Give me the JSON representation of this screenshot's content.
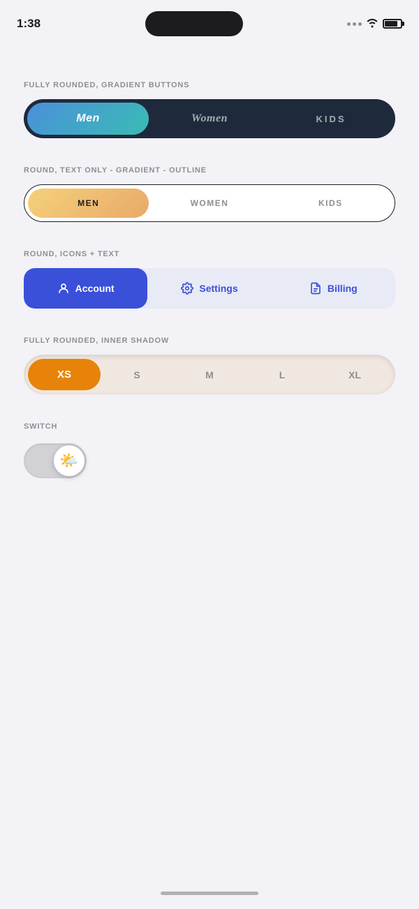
{
  "statusBar": {
    "time": "1:38"
  },
  "sections": {
    "gradientPill": {
      "label": "FULLY ROUNDED, GRADIENT BUTTONS",
      "buttons": [
        {
          "id": "men",
          "label": "Men",
          "active": true
        },
        {
          "id": "women",
          "label": "Women",
          "active": false
        },
        {
          "id": "kids",
          "label": "KIDS",
          "active": false
        }
      ]
    },
    "outlinePill": {
      "label": "ROUND, TEXT ONLY - GRADIENT - OUTLINE",
      "buttons": [
        {
          "id": "men",
          "label": "MEN",
          "active": true
        },
        {
          "id": "women",
          "label": "WOMEN",
          "active": false
        },
        {
          "id": "kids",
          "label": "KIDS",
          "active": false
        }
      ]
    },
    "iconText": {
      "label": "ROUND, ICONS + TEXT",
      "buttons": [
        {
          "id": "account",
          "label": "Account",
          "icon": "person",
          "active": true
        },
        {
          "id": "settings",
          "label": "Settings",
          "icon": "gear",
          "active": false
        },
        {
          "id": "billing",
          "label": "Billing",
          "icon": "receipt",
          "active": false
        }
      ]
    },
    "innerShadow": {
      "label": "FULLY ROUNDED, INNER SHADOW",
      "buttons": [
        {
          "id": "xs",
          "label": "XS",
          "active": true
        },
        {
          "id": "s",
          "label": "S",
          "active": false
        },
        {
          "id": "m",
          "label": "M",
          "active": false
        },
        {
          "id": "l",
          "label": "L",
          "active": false
        },
        {
          "id": "xl",
          "label": "XL",
          "active": false
        }
      ]
    },
    "toggle": {
      "label": "SWITCH",
      "sunEmoji": "🌤️"
    }
  }
}
